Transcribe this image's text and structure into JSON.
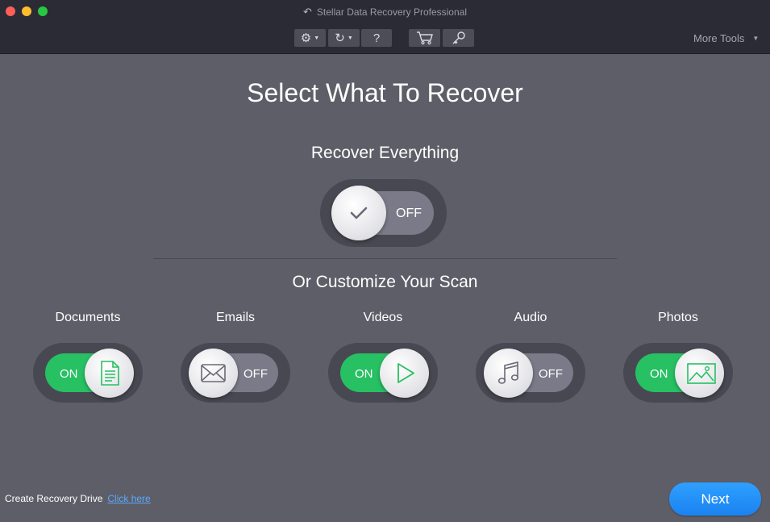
{
  "window": {
    "title": "Stellar Data Recovery Professional"
  },
  "toolbar": {
    "help_label": "?",
    "more_tools_label": "More Tools"
  },
  "main": {
    "title": "Select What To Recover",
    "recover_everything": {
      "label": "Recover Everything",
      "state": "OFF"
    },
    "customize_label": "Or Customize Your Scan",
    "categories": [
      {
        "label": "Documents",
        "state": "ON",
        "icon": "document-icon"
      },
      {
        "label": "Emails",
        "state": "OFF",
        "icon": "envelope-icon"
      },
      {
        "label": "Videos",
        "state": "ON",
        "icon": "play-icon"
      },
      {
        "label": "Audio",
        "state": "OFF",
        "icon": "music-note-icon"
      },
      {
        "label": "Photos",
        "state": "ON",
        "icon": "image-icon"
      }
    ]
  },
  "footer": {
    "recovery_drive_label": "Create Recovery Drive",
    "click_here_label": "Click here",
    "next_label": "Next"
  },
  "colors": {
    "accent_green": "#27c063",
    "next_blue": "#1a82f0",
    "link_blue": "#5aa9ff",
    "background": "#5e5e68"
  }
}
